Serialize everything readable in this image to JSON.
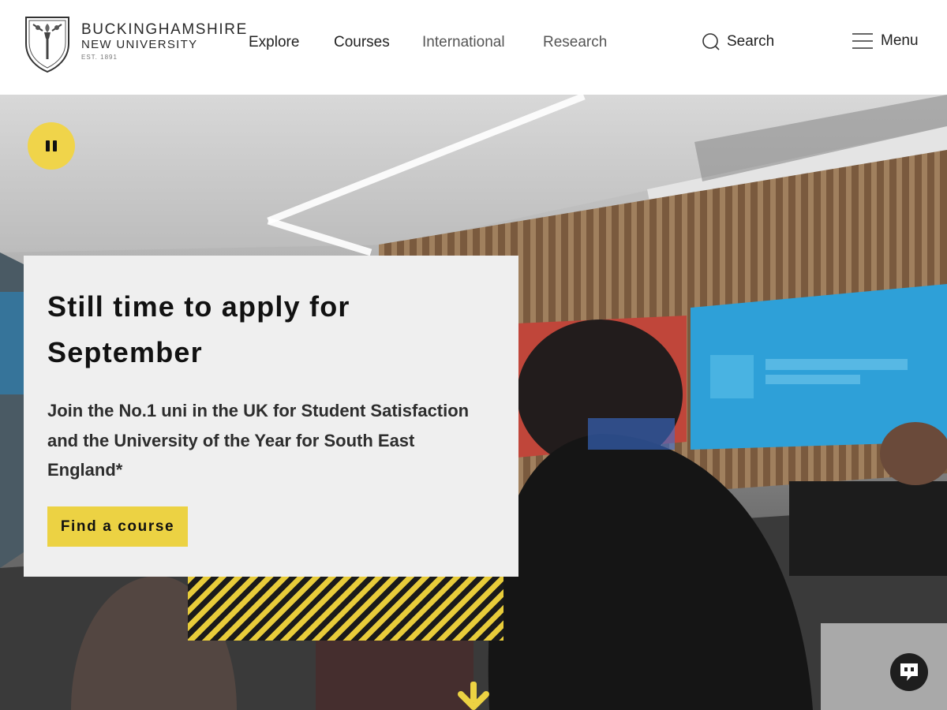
{
  "brand": {
    "line1": "BUCKINGHAMSHIRE",
    "line2": "NEW UNIVERSITY",
    "line3": "EST. 1891"
  },
  "nav": {
    "items": [
      {
        "label": "Explore"
      },
      {
        "label": "Courses"
      },
      {
        "label": "International"
      },
      {
        "label": "Research"
      }
    ],
    "search_label": "Search",
    "menu_label": "Menu"
  },
  "hero": {
    "title": "Still time to apply for September",
    "body": "Join the No.1 uni in the UK for Student Satisfaction and the University of the Year for South East England*",
    "cta_label": "Find a course",
    "icons": {
      "pause": "pause-icon",
      "scroll": "arrow-down-icon",
      "chat": "chat-icon"
    }
  },
  "colors": {
    "accent_yellow": "#ecd243",
    "panel_bg": "#efefef",
    "header_bg": "#ffffff",
    "text_dark": "#111111"
  }
}
